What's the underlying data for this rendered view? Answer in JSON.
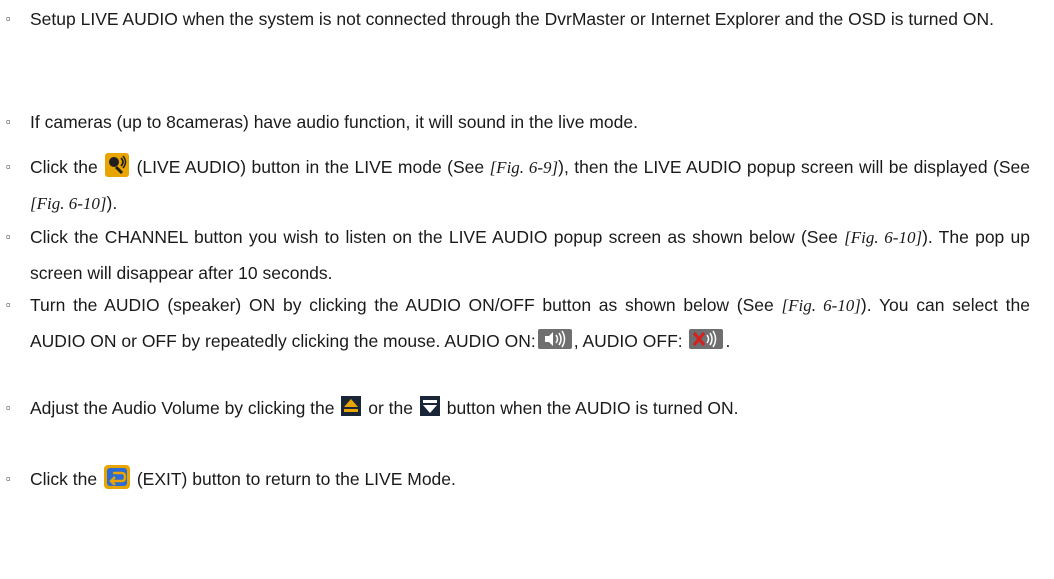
{
  "items": [
    {
      "text": "Setup LIVE AUDIO when the system is not connected through the DvrMaster or Internet Explorer and the OSD is turned ON."
    },
    {
      "text": " If cameras (up to 8cameras) have audio function, it will sound in the live mode."
    },
    {
      "p1": "Click the ",
      "p2": " (LIVE AUDIO) button in the LIVE mode (See ",
      "ref1": "[Fig. 6-9]",
      "p3": "), then the LIVE AUDIO popup screen will be displayed (See ",
      "ref2": "[Fig. 6-10]",
      "p4": ")."
    },
    {
      "p1": "Click the CHANNEL button you wish to listen on the LIVE AUDIO popup screen as shown below (See ",
      "ref1": "[Fig. 6-10]",
      "p2": "). The pop up screen will disappear after 10 seconds."
    },
    {
      "p1": "Turn the AUDIO (speaker) ON by clicking the AUDIO ON/OFF button as shown below (See ",
      "ref1": "[Fig. 6-10]",
      "p2": "). You can select the AUDIO ON or OFF by repeatedly clicking the mouse. AUDIO ON:",
      "p3": ", AUDIO OFF: ",
      "p4": "."
    },
    {
      "p1": "Adjust the Audio Volume by clicking the ",
      "p2": " or the ",
      "p3": " button when the AUDIO is turned ON."
    },
    {
      "p1": " Click the ",
      "p2": " (EXIT) button to return to the LIVE Mode."
    }
  ],
  "icons": {
    "live_audio": "live-audio-icon",
    "audio_on": "speaker-on-icon",
    "audio_off": "speaker-off-icon",
    "volume_up": "volume-up-icon",
    "volume_down": "volume-down-icon",
    "exit": "exit-icon"
  },
  "colors": {
    "icon_gold": "#e8a400",
    "icon_dark": "#1f1f1f",
    "speaker_gray": "#6f6f6f",
    "mute_red": "#d62020",
    "volume_bg": "#1a2638",
    "exit_blue": "#2a6bd6"
  }
}
